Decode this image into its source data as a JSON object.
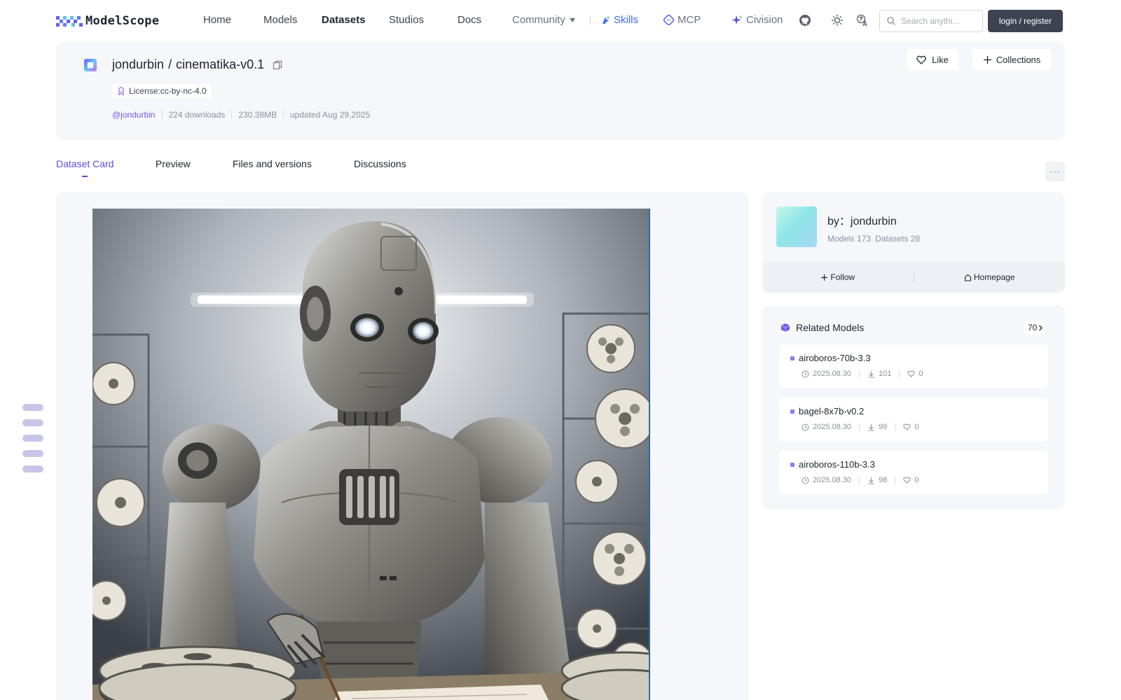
{
  "nav": {
    "logo_text": "ModelScope",
    "links": [
      "Home",
      "Models",
      "Datasets",
      "Studios",
      "Docs"
    ],
    "community_label": "Community",
    "skills_label": "Skills",
    "mcp_label": "MCP",
    "civision_label": "Civision",
    "search_placeholder": "Search anythi...",
    "login_label": "login / register"
  },
  "dataset": {
    "owner": "jondurbin",
    "separator": "/",
    "name": "cinematika-v0.1",
    "license": "License:cc-by-nc-4.0",
    "author_handle": "@jondurbin",
    "downloads": "224 downloads",
    "size": "230.38MB",
    "updated": "updated Aug 29,2025",
    "like_label": "Like",
    "collections_label": "Collections"
  },
  "tabs": [
    "Dataset Card",
    "Preview",
    "Files and versions",
    "Discussions"
  ],
  "more_label": "···",
  "author_card": {
    "by_label": "by：jondurbin",
    "models": "Models 173",
    "datasets": "Datasets 28",
    "follow_label": "Follow",
    "homepage_label": "Homepage"
  },
  "related": {
    "title": "Related Models",
    "count": "70",
    "items": [
      {
        "name": "airoboros-70b-3.3",
        "date": "2025.08.30",
        "downloads": "101",
        "likes": "0"
      },
      {
        "name": "bagel-8x7b-v0.2",
        "date": "2025.08.30",
        "downloads": "99",
        "likes": "0"
      },
      {
        "name": "airoboros-110b-3.3",
        "date": "2025.08.30",
        "downloads": "98",
        "likes": "0"
      }
    ]
  },
  "colors": {
    "accent": "#5b4de8",
    "panel_bg": "#f6f7fb",
    "login_bg": "#3e4351"
  },
  "icons": {
    "github": "github-icon",
    "theme": "sun-icon",
    "language": "translate-icon",
    "search": "search-icon"
  }
}
